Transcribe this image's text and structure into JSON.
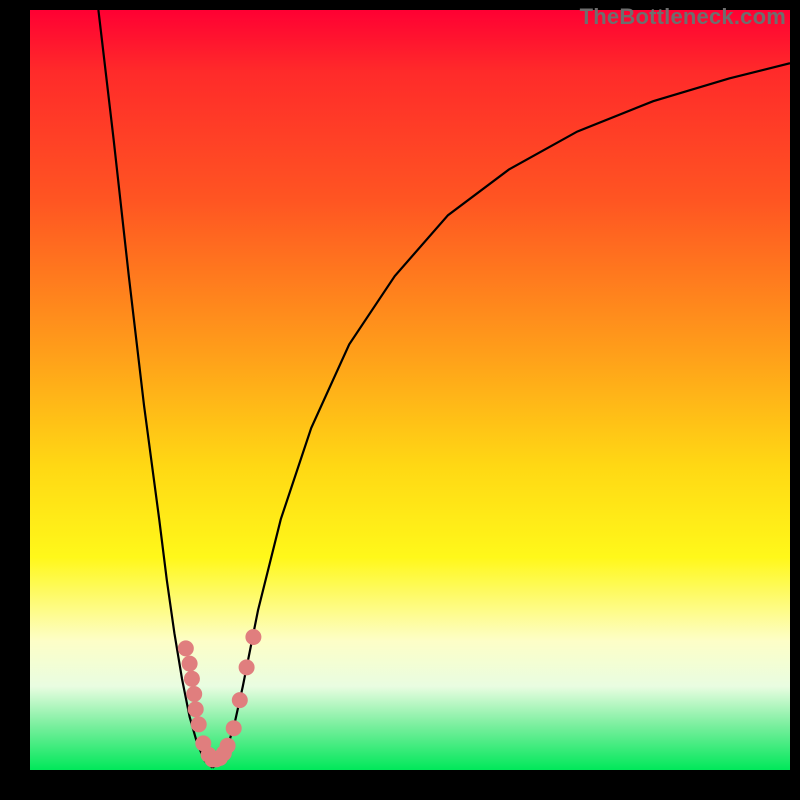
{
  "watermark": "TheBottleneck.com",
  "chart_data": {
    "type": "line",
    "title": "",
    "xlabel": "",
    "ylabel": "",
    "xlim": [
      0,
      100
    ],
    "ylim": [
      0,
      100
    ],
    "grid": false,
    "legend": false,
    "curve_left": [
      {
        "x": 9,
        "y": 100
      },
      {
        "x": 11,
        "y": 83
      },
      {
        "x": 13,
        "y": 65
      },
      {
        "x": 15,
        "y": 48
      },
      {
        "x": 17,
        "y": 33
      },
      {
        "x": 18,
        "y": 25
      },
      {
        "x": 19,
        "y": 18
      },
      {
        "x": 20,
        "y": 12
      },
      {
        "x": 21,
        "y": 7
      },
      {
        "x": 22,
        "y": 3.5
      },
      {
        "x": 23,
        "y": 1.2
      },
      {
        "x": 24,
        "y": 0.3
      }
    ],
    "curve_right": [
      {
        "x": 24,
        "y": 0.3
      },
      {
        "x": 25,
        "y": 1.0
      },
      {
        "x": 26,
        "y": 3.0
      },
      {
        "x": 27,
        "y": 6.5
      },
      {
        "x": 28,
        "y": 11
      },
      {
        "x": 30,
        "y": 21
      },
      {
        "x": 33,
        "y": 33
      },
      {
        "x": 37,
        "y": 45
      },
      {
        "x": 42,
        "y": 56
      },
      {
        "x": 48,
        "y": 65
      },
      {
        "x": 55,
        "y": 73
      },
      {
        "x": 63,
        "y": 79
      },
      {
        "x": 72,
        "y": 84
      },
      {
        "x": 82,
        "y": 88
      },
      {
        "x": 92,
        "y": 91
      },
      {
        "x": 100,
        "y": 93
      }
    ],
    "red_markers": [
      {
        "x": 20.5,
        "y": 16
      },
      {
        "x": 21.0,
        "y": 14
      },
      {
        "x": 21.3,
        "y": 12
      },
      {
        "x": 21.6,
        "y": 10
      },
      {
        "x": 21.8,
        "y": 8
      },
      {
        "x": 22.2,
        "y": 6
      },
      {
        "x": 22.8,
        "y": 3.5
      },
      {
        "x": 23.5,
        "y": 2.0
      },
      {
        "x": 24.0,
        "y": 1.4
      },
      {
        "x": 24.5,
        "y": 1.4
      },
      {
        "x": 25.0,
        "y": 1.6
      },
      {
        "x": 25.5,
        "y": 2.2
      },
      {
        "x": 26.0,
        "y": 3.2
      },
      {
        "x": 26.8,
        "y": 5.5
      },
      {
        "x": 27.6,
        "y": 9.2
      },
      {
        "x": 28.5,
        "y": 13.5
      },
      {
        "x": 29.4,
        "y": 17.5
      }
    ],
    "marker_color": "#e07e7e",
    "line_color": "#000000"
  }
}
